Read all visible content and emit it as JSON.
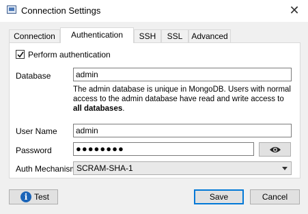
{
  "window": {
    "title": "Connection Settings",
    "icon": "app-window-icon",
    "close_icon": "close-icon"
  },
  "tabs": [
    {
      "label": "Connection",
      "active": false
    },
    {
      "label": "Authentication",
      "active": true
    },
    {
      "label": "SSH",
      "active": false
    },
    {
      "label": "SSL",
      "active": false
    },
    {
      "label": "Advanced",
      "active": false
    }
  ],
  "auth": {
    "perform_auth_label": "Perform authentication",
    "perform_auth_checked": true,
    "database_label": "Database",
    "database_value": "admin",
    "help_text_1": "The admin database is unique in MongoDB. Users with normal access to the admin database have read and write access to ",
    "help_text_bold": "all databases",
    "help_text_2": ".",
    "username_label": "User Name",
    "username_value": "admin",
    "password_label": "Password",
    "password_masked": "●●●●●●●●",
    "show_password_icon": "eye-icon",
    "mechanism_label": "Auth Mechanism",
    "mechanism_value": "SCRAM-SHA-1"
  },
  "footer": {
    "test_label": "Test",
    "test_icon": "info-icon",
    "save_label": "Save",
    "cancel_label": "Cancel"
  },
  "colors": {
    "accent": "#0078d7",
    "info_icon": "#1a64b8"
  }
}
